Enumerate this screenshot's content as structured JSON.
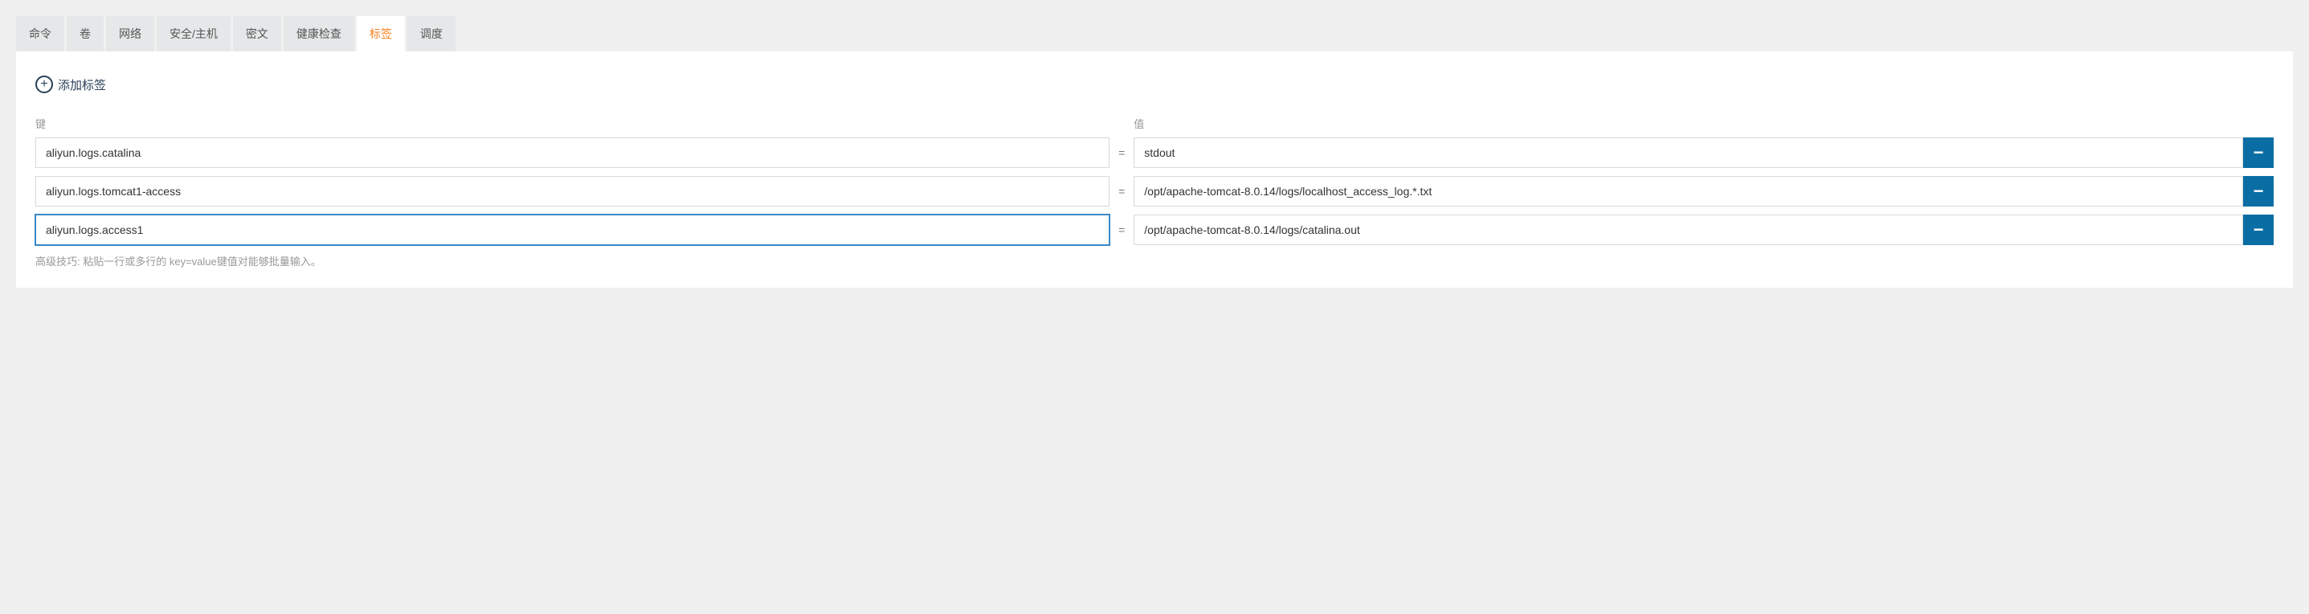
{
  "tabs": {
    "items": [
      {
        "label": "命令",
        "active": false
      },
      {
        "label": "卷",
        "active": false
      },
      {
        "label": "网络",
        "active": false
      },
      {
        "label": "安全/主机",
        "active": false
      },
      {
        "label": "密文",
        "active": false
      },
      {
        "label": "健康检查",
        "active": false
      },
      {
        "label": "标签",
        "active": true
      },
      {
        "label": "调度",
        "active": false
      }
    ]
  },
  "addLabel": "添加标签",
  "columns": {
    "key": "键",
    "value": "值"
  },
  "rows": [
    {
      "key": "aliyun.logs.catalina",
      "value": "stdout",
      "focused": false
    },
    {
      "key": "aliyun.logs.tomcat1-access",
      "value": "/opt/apache-tomcat-8.0.14/logs/localhost_access_log.*.txt",
      "focused": false
    },
    {
      "key": "aliyun.logs.access1",
      "value": "/opt/apache-tomcat-8.0.14/logs/catalina.out",
      "focused": true
    }
  ],
  "hint": "高级技巧: 粘贴一行或多行的 key=value键值对能够批量输入。",
  "eq": "=",
  "minus": "−"
}
